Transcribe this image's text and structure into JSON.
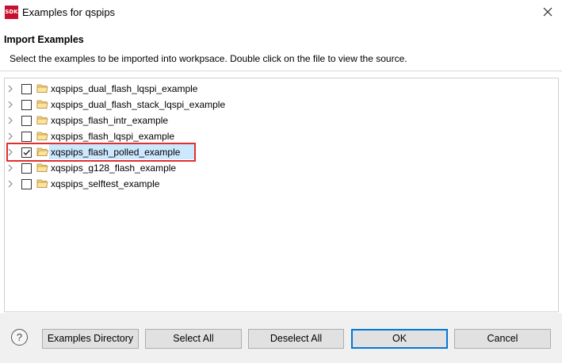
{
  "window": {
    "title": "Examples for qspips",
    "app_icon_text": "SDK",
    "close_icon": "close-icon"
  },
  "header": {
    "title": "Import Examples",
    "description": "Select the examples to be imported into workpsace. Double click on the file to view the source."
  },
  "tree": {
    "items": [
      {
        "label": "xqspips_dual_flash_lqspi_example",
        "checked": false,
        "selected": false
      },
      {
        "label": "xqspips_dual_flash_stack_lqspi_example",
        "checked": false,
        "selected": false
      },
      {
        "label": "xqspips_flash_intr_example",
        "checked": false,
        "selected": false
      },
      {
        "label": "xqspips_flash_lqspi_example",
        "checked": false,
        "selected": false
      },
      {
        "label": "xqspips_flash_polled_example",
        "checked": true,
        "selected": true
      },
      {
        "label": "xqspips_g128_flash_example",
        "checked": false,
        "selected": false
      },
      {
        "label": "xqspips_selftest_example",
        "checked": false,
        "selected": false
      }
    ]
  },
  "buttons": {
    "help": "?",
    "examples_directory": "Examples Directory",
    "select_all": "Select All",
    "deselect_all": "Deselect All",
    "ok": "OK",
    "cancel": "Cancel"
  },
  "colors": {
    "highlight_border": "#e0302e",
    "selection": "#cce8ff",
    "default_button_border": "#0078d7"
  }
}
